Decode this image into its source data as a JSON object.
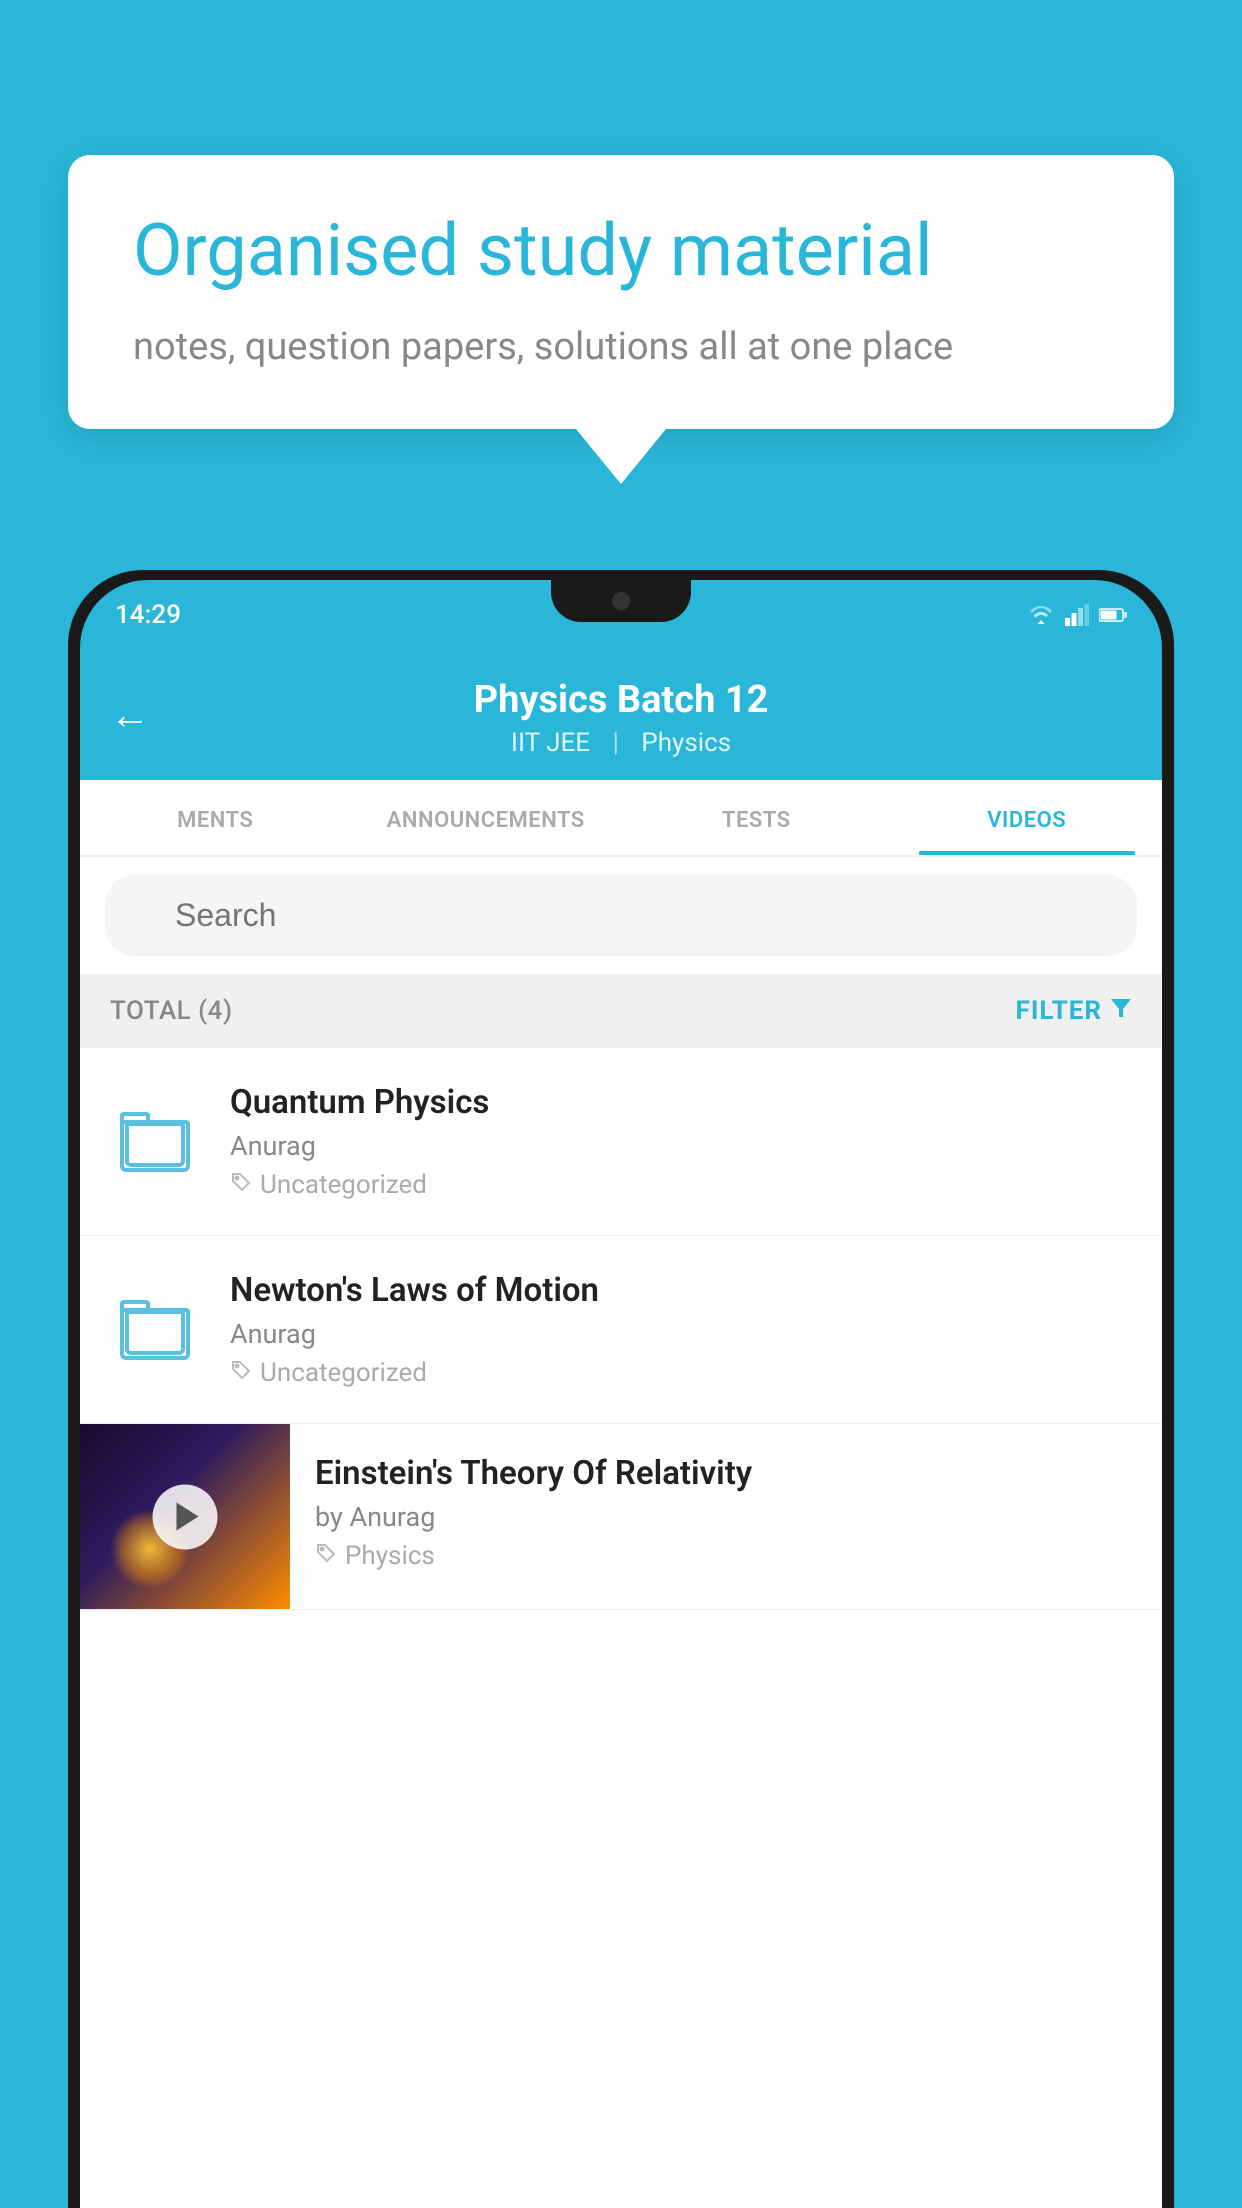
{
  "background": {
    "color": "#29b6d8"
  },
  "speechBubble": {
    "title": "Organised study material",
    "subtitle": "notes, question papers, solutions all at one place"
  },
  "phone": {
    "statusBar": {
      "time": "14:29"
    },
    "header": {
      "title": "Physics Batch 12",
      "subtitle_part1": "IIT JEE",
      "subtitle_part2": "Physics",
      "backLabel": "←"
    },
    "tabs": [
      {
        "label": "MENTS",
        "active": false
      },
      {
        "label": "ANNOUNCEMENTS",
        "active": false
      },
      {
        "label": "TESTS",
        "active": false
      },
      {
        "label": "VIDEOS",
        "active": true
      }
    ],
    "search": {
      "placeholder": "Search"
    },
    "filterBar": {
      "total": "TOTAL (4)",
      "filterLabel": "FILTER"
    },
    "videoItems": [
      {
        "id": 1,
        "title": "Quantum Physics",
        "author": "Anurag",
        "tag": "Uncategorized",
        "type": "folder",
        "hasThumbnail": false
      },
      {
        "id": 2,
        "title": "Newton's Laws of Motion",
        "author": "Anurag",
        "tag": "Uncategorized",
        "type": "folder",
        "hasThumbnail": false
      },
      {
        "id": 3,
        "title": "Einstein's Theory Of Relativity",
        "author": "by Anurag",
        "tag": "Physics",
        "type": "video",
        "hasThumbnail": true
      }
    ]
  }
}
